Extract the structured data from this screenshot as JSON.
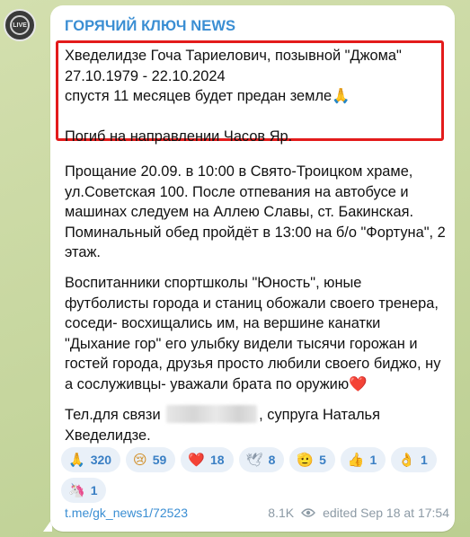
{
  "channel": {
    "name": "ГОРЯЧИЙ КЛЮЧ NEWS",
    "avatar_text": "LIVE"
  },
  "message": {
    "highlighted": "Хведелидзе Гоча Тариелович, позывной \"Джома\"\n27.10.1979 - 22.10.2024\nспустя 11 месяцев будет предан земле🙏\n\nПогиб на направлении Часов Яр.",
    "farewell": "Прощание 20.09. в 10:00 в Свято-Троицком храме, ул.Советская 100. После отпевания на автобусе и машинах следуем на Аллею Славы, ст. Бакинская. Поминальный обед пройдёт в 13:00 на б/о \"Фортуна\", 2 этаж.",
    "students": "Воспитанники спортшколы \"Юность\", юные футболисты города и станиц обожали своего тренера, соседи- восхищались им, на вершине канатки \"Дыхание гор\" его улыбку видели тысячи горожан и гостей города, друзья просто любили своего биджо, ну а сослуживцы- уважали брата по оружию",
    "students_heart": "❤️",
    "contact_prefix": "Тел.для связи",
    "contact_suffix": ", супруга Наталья Хведелидзе."
  },
  "reactions": [
    {
      "emoji": "🙏",
      "count": "320"
    },
    {
      "emoji": "😢",
      "count": "59"
    },
    {
      "emoji": "❤️",
      "count": "18"
    },
    {
      "emoji": "🕊",
      "count": "8"
    },
    {
      "emoji": "🫡",
      "count": "5"
    },
    {
      "emoji": "👍",
      "count": "1"
    },
    {
      "emoji": "👌",
      "count": "1"
    },
    {
      "emoji": "🦄",
      "count": "1"
    }
  ],
  "footer": {
    "link": "t.me/gk_news1/72523",
    "views": "8.1K",
    "edited": "edited Sep 18 at 17:54"
  }
}
